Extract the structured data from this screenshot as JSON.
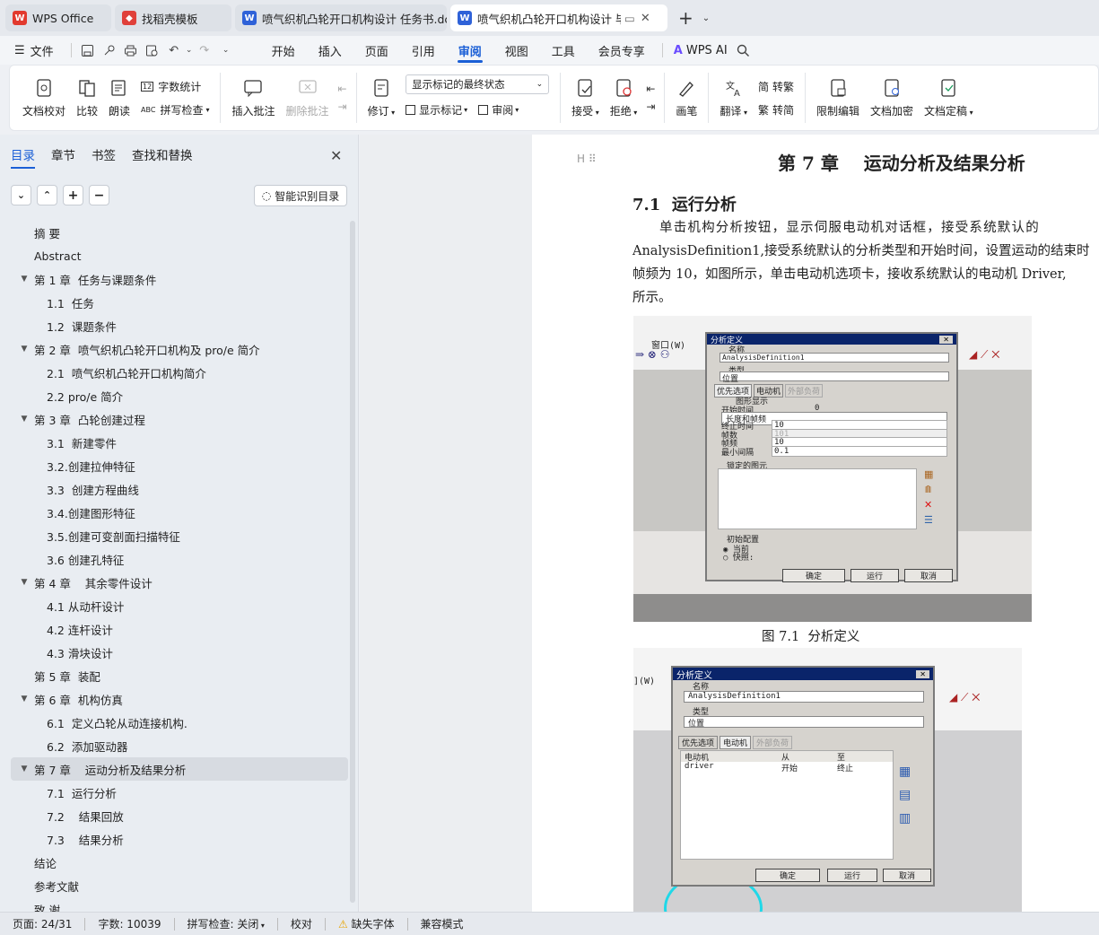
{
  "tabs": [
    {
      "label": "WPS Office",
      "icon": "wps-logo-icon"
    },
    {
      "label": "找稻壳模板",
      "icon": "docer-icon"
    },
    {
      "label": "喷气织机凸轮开口机构设计 任务书.dc",
      "icon": "word-doc-icon"
    },
    {
      "label": "喷气织机凸轮开口机构设计 毕",
      "icon": "word-doc-icon"
    }
  ],
  "menubar": {
    "file": "文件",
    "items": [
      "开始",
      "插入",
      "页面",
      "引用",
      "审阅",
      "视图",
      "工具",
      "会员专享"
    ],
    "active": "审阅",
    "wps_ai": "WPS AI"
  },
  "ribbon": {
    "doc_check": "文档校对",
    "compare": "比较",
    "read_aloud": "朗读",
    "word_count": "字数统计",
    "spell_check": "拼写检查",
    "insert_comment": "插入批注",
    "delete_comment": "删除批注",
    "revise": "修订",
    "markup_select": "显示标记的最终状态",
    "show_markup": "显示标记",
    "review": "审阅",
    "accept": "接受",
    "reject": "拒绝",
    "pen": "画笔",
    "translate": "翻译",
    "to_traditional": "转繁",
    "to_simplified": "转简",
    "restrict_edit": "限制编辑",
    "encrypt": "文档加密",
    "finalize": "文档定稿"
  },
  "nav": {
    "tabs": [
      "目录",
      "章节",
      "书签",
      "查找和替换"
    ],
    "smart_btn": "智能识别目录",
    "items": [
      {
        "label": "摘 要",
        "level": 1,
        "arrow": false
      },
      {
        "label": "Abstract",
        "level": 1,
        "arrow": false
      },
      {
        "label": "第 1 章  任务与课题条件",
        "level": 1,
        "arrow": true
      },
      {
        "label": "1.1  任务",
        "level": 2,
        "arrow": false
      },
      {
        "label": "1.2  课题条件",
        "level": 2,
        "arrow": false
      },
      {
        "label": "第 2 章  喷气织机凸轮开口机构及 pro/e 简介",
        "level": 1,
        "arrow": true
      },
      {
        "label": "2.1  喷气织机凸轮开口机构简介",
        "level": 2,
        "arrow": false
      },
      {
        "label": "2.2 pro/e 简介",
        "level": 2,
        "arrow": false
      },
      {
        "label": "第 3 章  凸轮创建过程",
        "level": 1,
        "arrow": true
      },
      {
        "label": "3.1  新建零件",
        "level": 2,
        "arrow": false
      },
      {
        "label": "3.2.创建拉伸特征",
        "level": 2,
        "arrow": false
      },
      {
        "label": "3.3  创建方程曲线",
        "level": 2,
        "arrow": false
      },
      {
        "label": "3.4.创建图形特征",
        "level": 2,
        "arrow": false
      },
      {
        "label": "3.5.创建可变剖面扫描特征",
        "level": 2,
        "arrow": false
      },
      {
        "label": "3.6 创建孔特征",
        "level": 2,
        "arrow": false
      },
      {
        "label": "第 4 章    其余零件设计",
        "level": 1,
        "arrow": true
      },
      {
        "label": "4.1 从动杆设计",
        "level": 2,
        "arrow": false
      },
      {
        "label": "4.2 连杆设计",
        "level": 2,
        "arrow": false
      },
      {
        "label": "4.3 滑块设计",
        "level": 2,
        "arrow": false
      },
      {
        "label": "第 5 章  装配",
        "level": 1,
        "arrow": false
      },
      {
        "label": "第 6 章  机构仿真",
        "level": 1,
        "arrow": true
      },
      {
        "label": "6.1  定义凸轮从动连接机构.",
        "level": 2,
        "arrow": false
      },
      {
        "label": "6.2  添加驱动器",
        "level": 2,
        "arrow": false
      },
      {
        "label": "第 7 章    运动分析及结果分析",
        "level": 1,
        "arrow": true,
        "selected": true
      },
      {
        "label": "7.1  运行分析",
        "level": 2,
        "arrow": false
      },
      {
        "label": "7.2    结果回放",
        "level": 2,
        "arrow": false
      },
      {
        "label": "7.3    结果分析",
        "level": 2,
        "arrow": false
      },
      {
        "label": "结论",
        "level": 1,
        "arrow": false
      },
      {
        "label": "参考文献",
        "level": 1,
        "arrow": false
      },
      {
        "label": "致 谢",
        "level": 1,
        "arrow": false
      }
    ]
  },
  "document": {
    "chapter_title": "第 7 章    运动分析及结果分析",
    "section_title": "7.1  运行分析",
    "para_lines": [
      "单击机构分析按钮，显示伺服电动机对话框，接受系统默认的",
      "AnalysisDefinition1,接受系统默认的分析类型和开始时间，设置运动的结束时",
      "帧频为 10，如图所示，单击电动机选项卡，接收系统默认的电动机 Driver,",
      "所示。"
    ],
    "figure1_caption": "图 7.1  分析定义",
    "fig1": {
      "menu_window": "窗口(W)",
      "title": "分析定义",
      "name_label": "名称",
      "name_value": "AnalysisDefinition1",
      "type_label": "类型",
      "type_value": "位置",
      "tabs": [
        "优先选项",
        "电动机",
        "外部负荷"
      ],
      "graph_display": "图形显示",
      "start_time_label": "开始时间",
      "start_time_value": "0",
      "length_rate": "长度和帧频",
      "end_time_label": "终止时间",
      "end_time_value": "10",
      "frames_label": "帧数",
      "frames_value": "101",
      "rate_label": "帧频",
      "rate_value": "10",
      "min_interval_label": "最小间隔",
      "min_interval_value": "0.1",
      "locked_label": "锁定的图元",
      "init_config": "初始配置",
      "current": "当前",
      "snapshot": "快照:",
      "ok": "确定",
      "run": "运行",
      "cancel": "取消"
    },
    "fig2": {
      "menu_window": "](W)",
      "title": "分析定义",
      "name_label": "名称",
      "name_value": "AnalysisDefinition1",
      "type_label": "类型",
      "type_value": "位置",
      "tabs": [
        "优先选项",
        "电动机",
        "外部负荷"
      ],
      "col_motor": "电动机",
      "col_from": "从",
      "col_to": "至",
      "row_motor": "driver",
      "row_from": "开始",
      "row_to": "终止",
      "ok": "确定",
      "run": "运行",
      "cancel": "取消"
    }
  },
  "status": {
    "page": "页面: 24/31",
    "words": "字数: 10039",
    "spell": "拼写检查: 关闭",
    "proof": "校对",
    "missing_font": "缺失字体",
    "compat": "兼容模式"
  }
}
